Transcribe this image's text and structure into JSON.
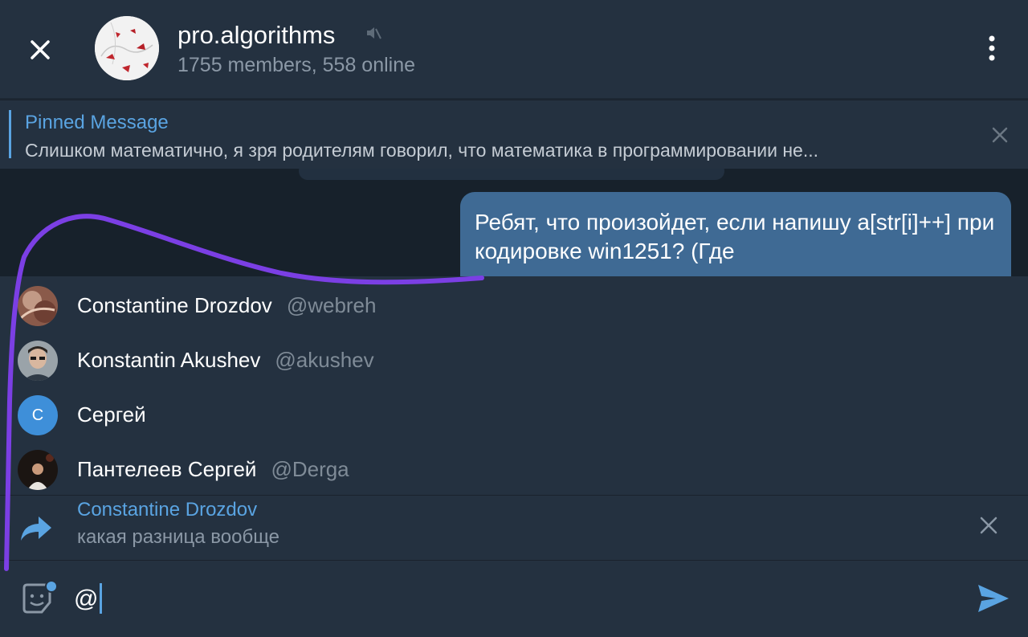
{
  "header": {
    "title": "pro.algorithms",
    "subtitle": "1755 members, 558 online",
    "close_icon": "close-icon",
    "mute_icon": "muted-speaker-icon",
    "menu_icon": "more-vertical-icon"
  },
  "pinned": {
    "label": "Pinned Message",
    "text": "Слишком математично, я зря родителям говорил, что математика в программировании не...",
    "close_icon": "close-icon"
  },
  "message": {
    "text": "Ребят, что произойдет, если напишу a[str[i]++] при кодировке win1251? (Где"
  },
  "mentions": [
    {
      "name": "Constantine Drozdov",
      "username": "@webreh",
      "avatar": "photo"
    },
    {
      "name": "Konstantin Akushev",
      "username": "@akushev",
      "avatar": "photo"
    },
    {
      "name": "Сергей",
      "username": "",
      "avatar_letter": "С",
      "avatar_color": "#3e8fd9"
    },
    {
      "name": "Пантелеев Сергей",
      "username": "@Derga",
      "avatar": "photo"
    }
  ],
  "reply": {
    "icon": "reply-arrow-icon",
    "name": "Constantine Drozdov",
    "text": "какая разница вообще"
  },
  "input": {
    "value": "@",
    "sticker_icon": "sticker-icon",
    "send_icon": "send-icon"
  },
  "colors": {
    "accent": "#5aa4e2",
    "panel": "#243140",
    "chat_bg": "#17212b",
    "bubble": "#3f6a94",
    "annotation_stroke": "#7b3fe4"
  }
}
